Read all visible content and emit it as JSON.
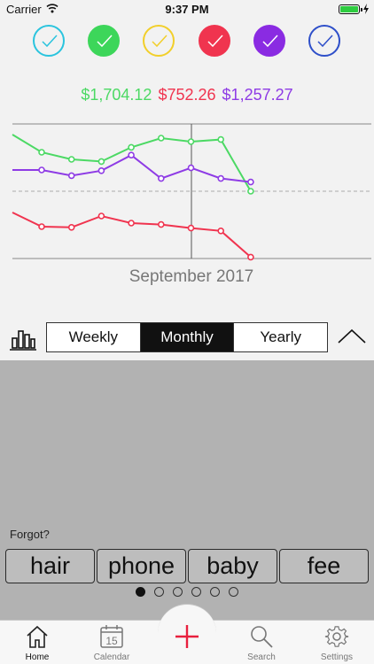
{
  "status_bar": {
    "carrier": "Carrier",
    "time": "9:37 PM"
  },
  "filters": [
    {
      "name": "filter-cyan",
      "color": "#2ac4de",
      "filled": false
    },
    {
      "name": "filter-green",
      "color": "#3dd65a",
      "filled": true
    },
    {
      "name": "filter-yellow",
      "color": "#f2cf2a",
      "filled": false
    },
    {
      "name": "filter-red",
      "color": "#f0344f",
      "filled": true
    },
    {
      "name": "filter-purple",
      "color": "#8a2be2",
      "filled": true
    },
    {
      "name": "filter-blue",
      "color": "#2e4fc9",
      "filled": false
    }
  ],
  "totals": [
    {
      "amount": "$1,704.12",
      "color": "#4cd964"
    },
    {
      "amount": "$752.26",
      "color": "#f0344f"
    },
    {
      "amount": "$1,257.27",
      "color": "#8e3be5"
    }
  ],
  "chart_data": {
    "type": "line",
    "grid": false,
    "series": [
      {
        "color": "#4cd964",
        "values": [
          0.8,
          0.55,
          0.45,
          0.42,
          0.62,
          0.75,
          0.7,
          0.73,
          0.0
        ]
      },
      {
        "color": "#8e3be5",
        "values": [
          0.3,
          0.3,
          0.22,
          0.29,
          0.51,
          0.18,
          0.33,
          0.18,
          0.13
        ]
      },
      {
        "color": "#f0344f",
        "values": [
          -0.3,
          -0.5,
          -0.51,
          -0.35,
          -0.45,
          -0.47,
          -0.52,
          -0.56,
          -0.93
        ]
      }
    ],
    "reference_line": 0.0
  },
  "month_label": "September 2017",
  "period_tabs": [
    {
      "label": "Weekly",
      "active": false
    },
    {
      "label": "Monthly",
      "active": true
    },
    {
      "label": "Yearly",
      "active": false
    }
  ],
  "forgot_label": "Forgot?",
  "words": [
    "hair",
    "phone",
    "baby",
    "fee"
  ],
  "page_dots": {
    "count": 6,
    "active_index": 0
  },
  "tabs": [
    {
      "name": "home",
      "label": "Home",
      "icon": "home-icon",
      "active": true
    },
    {
      "name": "calendar",
      "label": "Calendar",
      "icon": "calendar-icon",
      "active": false,
      "date": "15"
    },
    {
      "name": "search",
      "label": "Search",
      "icon": "search-icon",
      "active": false
    },
    {
      "name": "settings",
      "label": "Settings",
      "icon": "gear-icon",
      "active": false
    }
  ],
  "add_button": {
    "icon": "plus-icon",
    "color": "#e8203e"
  }
}
